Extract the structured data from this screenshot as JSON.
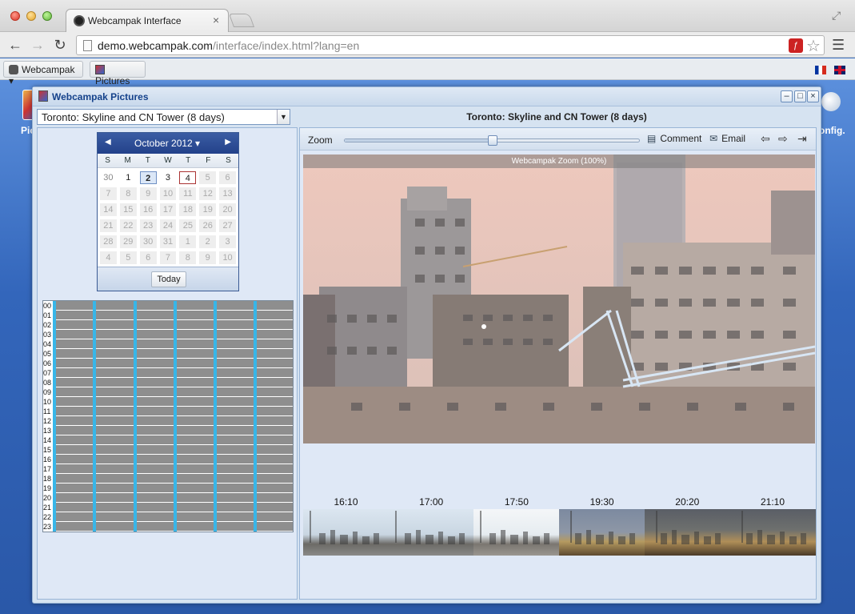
{
  "browser": {
    "tab_title": "Webcampak Interface",
    "url_host": "demo.webcampak.com",
    "url_path": "/interface/index.html?lang=en",
    "bookmarks": [
      {
        "label": "Webcampak"
      },
      {
        "label": "Pictures"
      }
    ]
  },
  "desktop": {
    "left_label": "Pic",
    "right_label": "onfig."
  },
  "window": {
    "title": "Webcampak Pictures",
    "source_select": "Toronto: Skyline and CN Tower (8 days)",
    "view_title": "Toronto: Skyline and CN Tower (8 days)"
  },
  "calendar": {
    "month_label": "October 2012",
    "dows": [
      "S",
      "M",
      "T",
      "W",
      "T",
      "F",
      "S"
    ],
    "weeks": [
      [
        "30",
        "1",
        "2",
        "3",
        "4",
        "5",
        "6"
      ],
      [
        "7",
        "8",
        "9",
        "10",
        "11",
        "12",
        "13"
      ],
      [
        "14",
        "15",
        "16",
        "17",
        "18",
        "19",
        "20"
      ],
      [
        "21",
        "22",
        "23",
        "24",
        "25",
        "26",
        "27"
      ],
      [
        "28",
        "29",
        "30",
        "31",
        "1",
        "2",
        "3"
      ],
      [
        "4",
        "5",
        "6",
        "7",
        "8",
        "9",
        "10"
      ]
    ],
    "today_button": "Today"
  },
  "timeline": {
    "hours": [
      "00",
      "01",
      "02",
      "03",
      "04",
      "05",
      "06",
      "07",
      "08",
      "09",
      "10",
      "11",
      "12",
      "13",
      "14",
      "15",
      "16",
      "17",
      "18",
      "19",
      "20",
      "21",
      "22",
      "23"
    ],
    "bar_color": "#8e8e8e",
    "marker_color": "#38b6e8"
  },
  "viewer": {
    "zoom_label": "Zoom",
    "zoom_level": 0.5,
    "comment_label": "Comment",
    "email_label": "Email",
    "caption": "Webcampak Zoom (100%)"
  },
  "thumbnails": [
    {
      "time": "16:10",
      "scene": "day"
    },
    {
      "time": "17:00",
      "scene": "day"
    },
    {
      "time": "17:50",
      "scene": "bright"
    },
    {
      "time": "19:30",
      "scene": "dusk"
    },
    {
      "time": "20:20",
      "scene": "night"
    },
    {
      "time": "21:10",
      "scene": "night"
    }
  ],
  "colors": {
    "window_title": "#15428b",
    "calendar_header": "#23418a"
  }
}
